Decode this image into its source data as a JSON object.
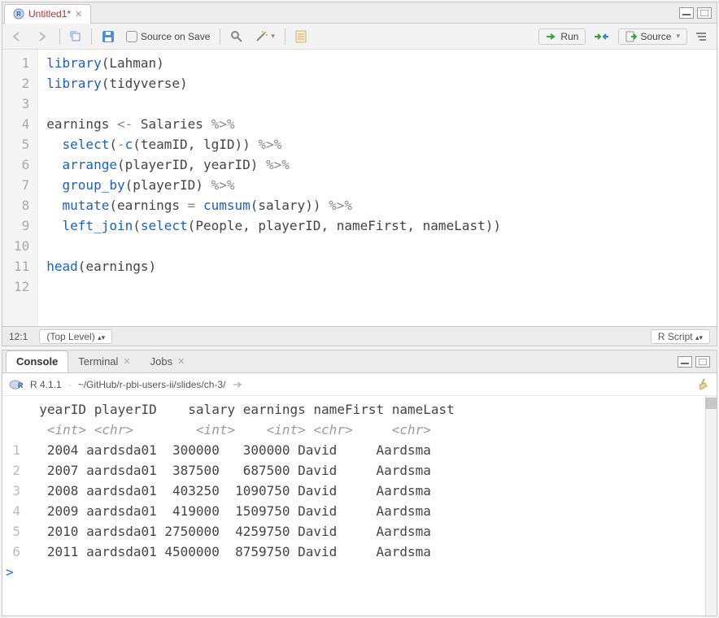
{
  "editorTab": {
    "title": "Untitled1*"
  },
  "toolbar": {
    "sourceOnSave": "Source on Save",
    "run": "Run",
    "source": "Source"
  },
  "code": {
    "lines": [
      {
        "n": 1,
        "seg": [
          [
            "fn",
            "library"
          ],
          [
            "paren",
            "("
          ],
          [
            "plain",
            "Lahman"
          ],
          [
            "paren",
            ")"
          ]
        ]
      },
      {
        "n": 2,
        "seg": [
          [
            "fn",
            "library"
          ],
          [
            "paren",
            "("
          ],
          [
            "plain",
            "tidyverse"
          ],
          [
            "paren",
            ")"
          ]
        ]
      },
      {
        "n": 3,
        "seg": []
      },
      {
        "n": 4,
        "seg": [
          [
            "plain",
            "earnings "
          ],
          [
            "op",
            "<-"
          ],
          [
            "plain",
            " Salaries "
          ],
          [
            "op",
            "%>%"
          ]
        ]
      },
      {
        "n": 5,
        "seg": [
          [
            "plain",
            "  "
          ],
          [
            "fn",
            "select"
          ],
          [
            "paren",
            "("
          ],
          [
            "op",
            "-"
          ],
          [
            "fn",
            "c"
          ],
          [
            "paren",
            "("
          ],
          [
            "plain",
            "teamID, lgID"
          ],
          [
            "paren",
            "))"
          ],
          [
            "plain",
            " "
          ],
          [
            "op",
            "%>%"
          ]
        ]
      },
      {
        "n": 6,
        "seg": [
          [
            "plain",
            "  "
          ],
          [
            "fn",
            "arrange"
          ],
          [
            "paren",
            "("
          ],
          [
            "plain",
            "playerID, yearID"
          ],
          [
            "paren",
            ")"
          ],
          [
            "plain",
            " "
          ],
          [
            "op",
            "%>%"
          ]
        ]
      },
      {
        "n": 7,
        "seg": [
          [
            "plain",
            "  "
          ],
          [
            "fn",
            "group_by"
          ],
          [
            "paren",
            "("
          ],
          [
            "plain",
            "playerID"
          ],
          [
            "paren",
            ")"
          ],
          [
            "plain",
            " "
          ],
          [
            "op",
            "%>%"
          ]
        ]
      },
      {
        "n": 8,
        "seg": [
          [
            "plain",
            "  "
          ],
          [
            "fn",
            "mutate"
          ],
          [
            "paren",
            "("
          ],
          [
            "plain",
            "earnings "
          ],
          [
            "op",
            "="
          ],
          [
            "plain",
            " "
          ],
          [
            "fn",
            "cumsum"
          ],
          [
            "paren",
            "("
          ],
          [
            "plain",
            "salary"
          ],
          [
            "paren",
            "))"
          ],
          [
            "plain",
            " "
          ],
          [
            "op",
            "%>%"
          ]
        ]
      },
      {
        "n": 9,
        "seg": [
          [
            "plain",
            "  "
          ],
          [
            "fn",
            "left_join"
          ],
          [
            "paren",
            "("
          ],
          [
            "fn",
            "select"
          ],
          [
            "paren",
            "("
          ],
          [
            "plain",
            "People, playerID, nameFirst, nameLast"
          ],
          [
            "paren",
            "))"
          ]
        ]
      },
      {
        "n": 10,
        "seg": []
      },
      {
        "n": 11,
        "seg": [
          [
            "fn",
            "head"
          ],
          [
            "paren",
            "("
          ],
          [
            "plain",
            "earnings"
          ],
          [
            "paren",
            ")"
          ]
        ]
      },
      {
        "n": 12,
        "seg": []
      }
    ]
  },
  "status": {
    "cursor": "12:1",
    "scope": "(Top Level)",
    "lang": "R Script"
  },
  "consoleTabs": {
    "console": "Console",
    "terminal": "Terminal",
    "jobs": "Jobs"
  },
  "consoleInfo": {
    "version": "R 4.1.1",
    "path": "~/GitHub/r-pbi-users-ii/slides/ch-3/"
  },
  "consoleOutput": {
    "header": "  yearID playerID    salary earnings nameFirst nameLast",
    "types": "   <int> <chr>        <int>    <int> <chr>     <chr>",
    "rows": [
      {
        "n": "1",
        "text": "   2004 aardsda01  300000   300000 David     Aardsma"
      },
      {
        "n": "2",
        "text": "   2007 aardsda01  387500   687500 David     Aardsma"
      },
      {
        "n": "3",
        "text": "   2008 aardsda01  403250  1090750 David     Aardsma"
      },
      {
        "n": "4",
        "text": "   2009 aardsda01  419000  1509750 David     Aardsma"
      },
      {
        "n": "5",
        "text": "   2010 aardsda01 2750000  4259750 David     Aardsma"
      },
      {
        "n": "6",
        "text": "   2011 aardsda01 4500000  8759750 David     Aardsma"
      }
    ],
    "prompt": ">"
  }
}
